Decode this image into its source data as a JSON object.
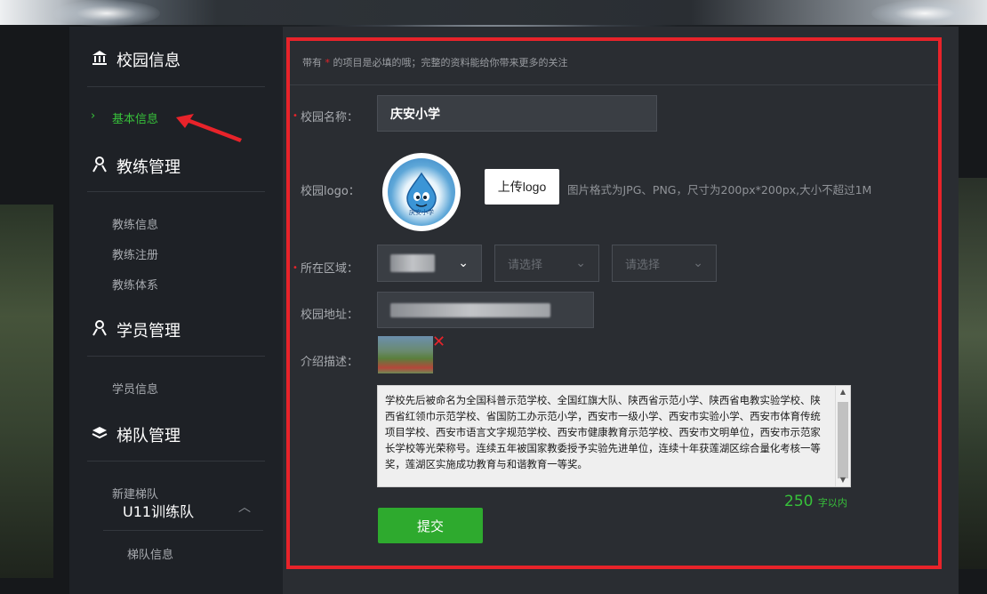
{
  "sidebar": {
    "campus": {
      "title": "校园信息",
      "icon": "building-icon",
      "items": [
        "基本信息"
      ]
    },
    "coach": {
      "title": "教练管理",
      "icon": "user-icon",
      "items": [
        "教练信息",
        "教练注册",
        "教练体系"
      ]
    },
    "student": {
      "title": "学员管理",
      "icon": "user-icon",
      "items": [
        "学员信息"
      ]
    },
    "team": {
      "title": "梯队管理",
      "icon": "layers-icon",
      "items": [
        "新建梯队"
      ],
      "group": "U11训练队",
      "group_items": [
        "梯队信息"
      ]
    }
  },
  "form": {
    "notice_prefix": "带有",
    "notice_star": "*",
    "notice_suffix": "的项目是必填的哦；完整的资料能给你带来更多的关注",
    "name_label": "校园名称：",
    "name_value": "庆安小学",
    "logo_label": "校园logo：",
    "upload_label": "上传logo",
    "upload_hint": "图片格式为JPG、PNG，尺寸为200px*200px,大小不超过1M",
    "logo_text": "庆安小学",
    "region_label": "所在区域：",
    "region_placeholder_2": "请选择",
    "region_placeholder_3": "请选择",
    "address_label": "校园地址：",
    "desc_label": "介绍描述：",
    "desc_text": "学校先后被命名为全国科普示范学校、全国红旗大队、陕西省示范小学、陕西省电教实验学校、陕西省红领巾示范学校、省国防工办示范小学，西安市一级小学、西安市实验小学、西安市体育传统项目学校、西安市语言文字规范学校、西安市健康教育示范学校、西安市文明单位，西安市示范家长学校等光荣称号。连续五年被国家教委授予实验先进单位，连续十年获莲湖区综合量化考核一等奖，莲湖区实施成功教育与和谐教育一等奖。",
    "counter_value": "250",
    "counter_unit": "字以内",
    "submit_label": "提交"
  },
  "colors": {
    "accent_green": "#37c13a",
    "required_red": "#e8232a",
    "submit_green": "#2eaa2e"
  }
}
